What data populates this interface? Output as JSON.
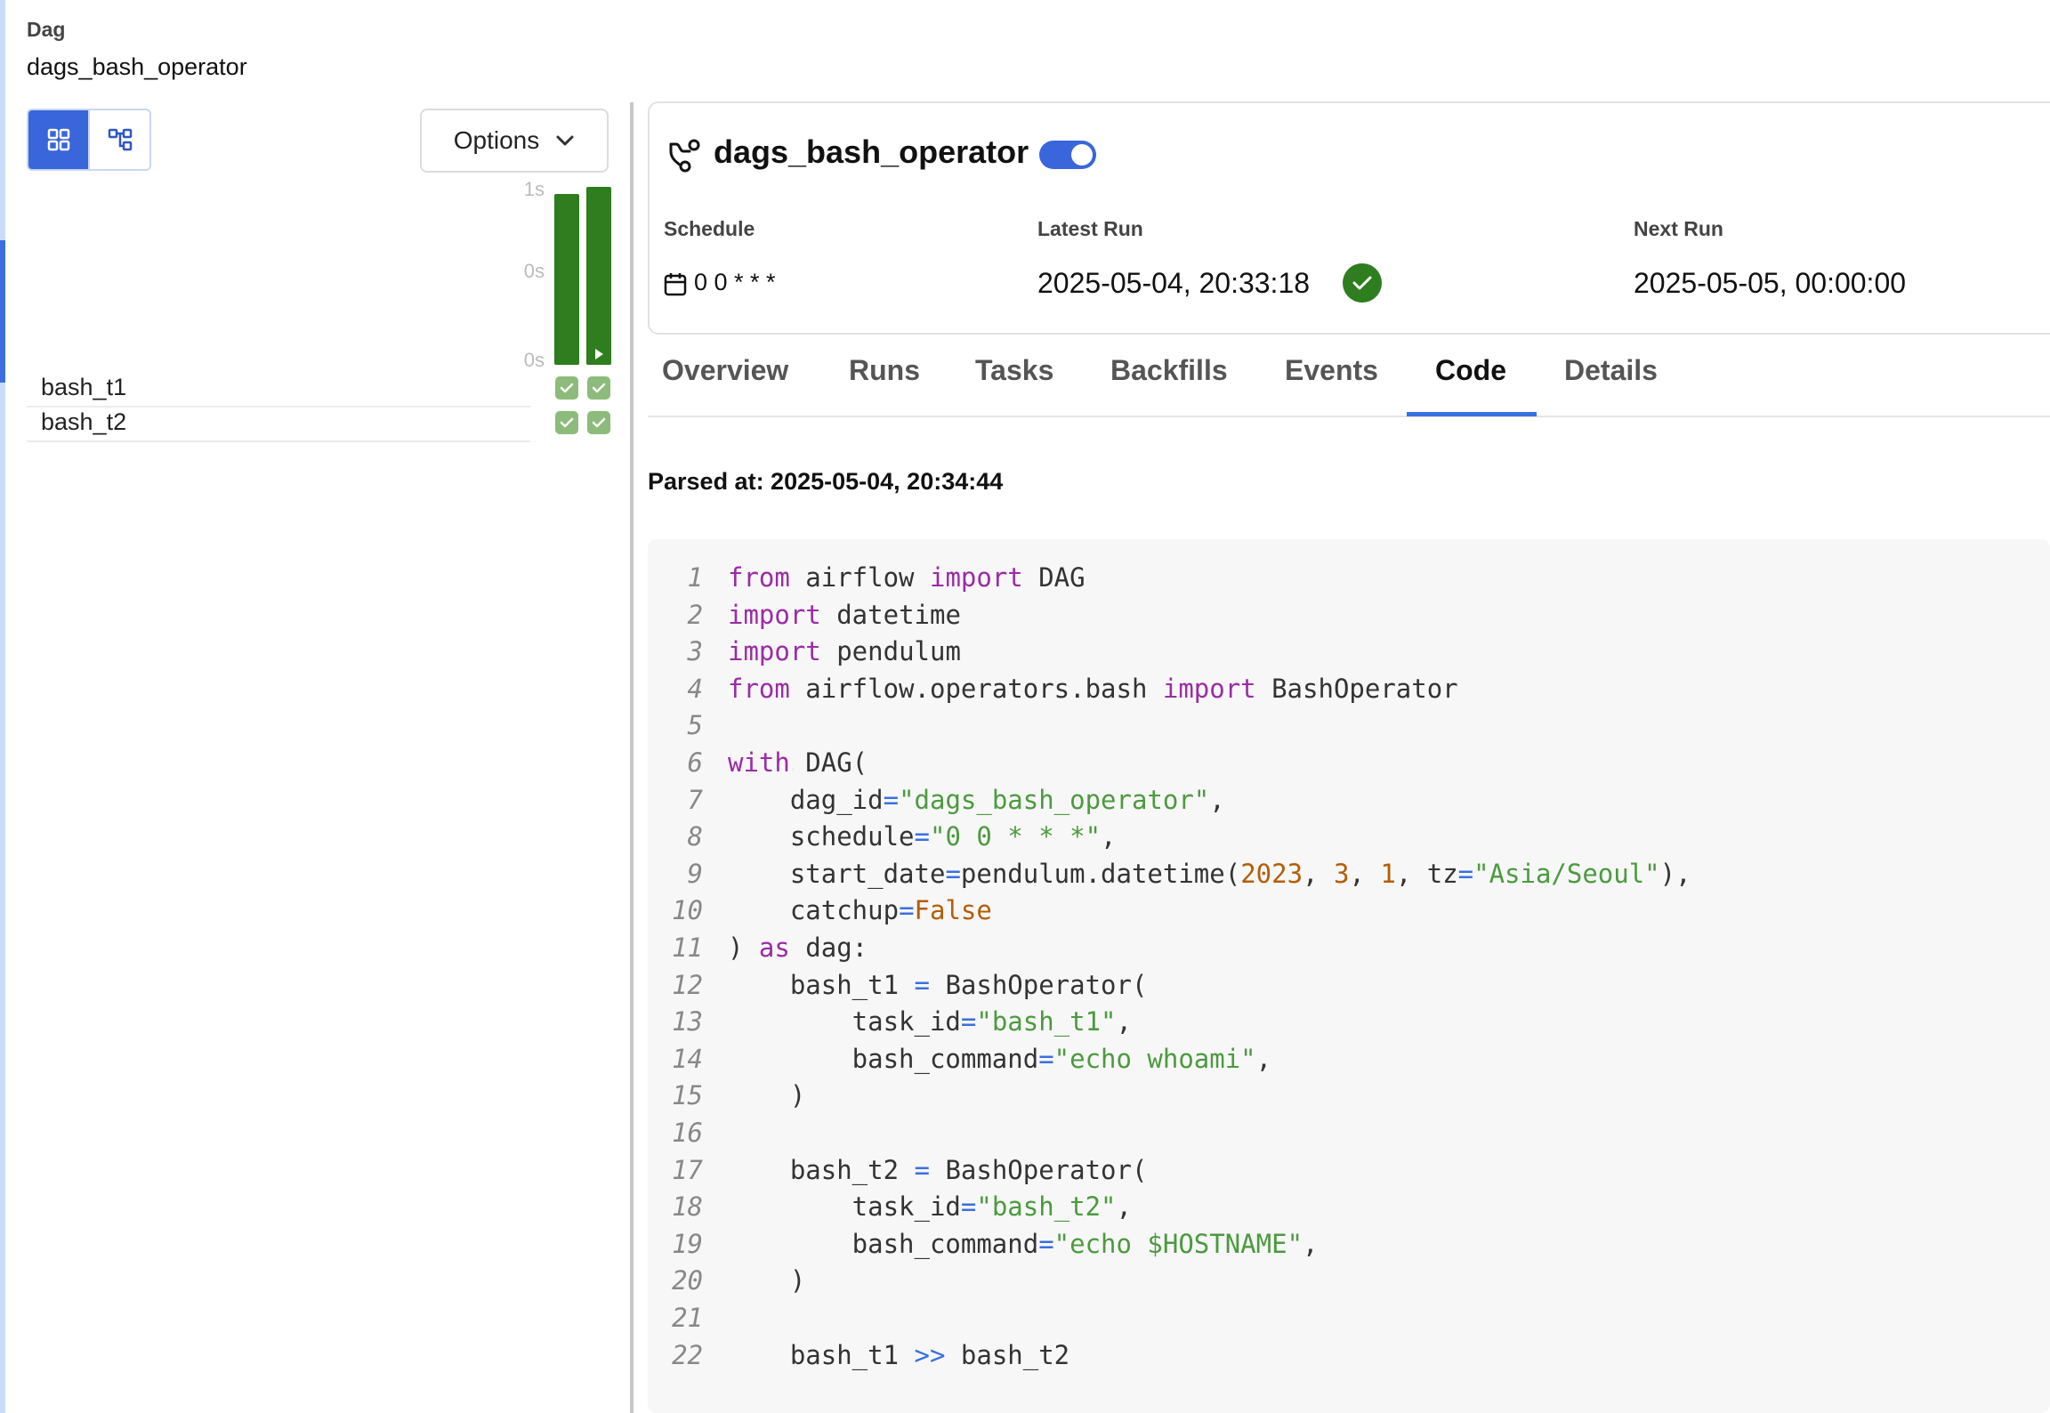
{
  "breadcrumb": {
    "label": "Dag",
    "value": "dags_bash_operator"
  },
  "view_toggle": {
    "grid_icon": "grid-view-icon",
    "graph_icon": "graph-view-icon"
  },
  "options": {
    "label": "Options",
    "icon": "chevron-down-icon"
  },
  "grid": {
    "axis_labels": [
      "1s",
      "0s",
      "0s"
    ],
    "runs": [
      {
        "duration_fraction": 0.96,
        "state": "success"
      },
      {
        "duration_fraction": 1.0,
        "state": "success",
        "running_marker": "play-icon"
      }
    ],
    "tasks": [
      {
        "name": "bash_t1",
        "states": [
          "success",
          "success"
        ]
      },
      {
        "name": "bash_t2",
        "states": [
          "success",
          "success"
        ]
      }
    ]
  },
  "header": {
    "dag_icon": "dag-icon",
    "title": "dags_bash_operator",
    "paused": false,
    "schedule_label": "Schedule",
    "schedule_value": "0 0 * * *",
    "latest_run_label": "Latest Run",
    "latest_run_value": "2025-05-04, 20:33:18",
    "latest_run_state_icon": "success-check-icon",
    "next_run_label": "Next Run",
    "next_run_value": "2025-05-05, 00:00:00"
  },
  "tabs": [
    "Overview",
    "Runs",
    "Tasks",
    "Backfills",
    "Events",
    "Code",
    "Details"
  ],
  "active_tab": "Code",
  "parsed_at": "Parsed at: 2025-05-04, 20:34:44",
  "code_lines": [
    "from airflow import DAG",
    "import datetime",
    "import pendulum",
    "from airflow.operators.bash import BashOperator",
    "",
    "with DAG(",
    "    dag_id=\"dags_bash_operator\",",
    "    schedule=\"0 0 * * *\",",
    "    start_date=pendulum.datetime(2023, 3, 1, tz=\"Asia/Seoul\"),",
    "    catchup=False",
    ") as dag:",
    "    bash_t1 = BashOperator(",
    "        task_id=\"bash_t1\",",
    "        bash_command=\"echo whoami\",",
    "    )",
    "",
    "    bash_t2 = BashOperator(",
    "        task_id=\"bash_t2\",",
    "        bash_command=\"echo $HOSTNAME\",",
    "    )",
    "",
    "    bash_t1 >> bash_t2"
  ],
  "colors": {
    "accent": "#3a66db",
    "success": "#2e7d1f",
    "success_light": "#8dbb7c",
    "keyword": "#9b2ba6",
    "string": "#4c9a3f",
    "number": "#b45d07",
    "operator": "#3a6fe0"
  }
}
